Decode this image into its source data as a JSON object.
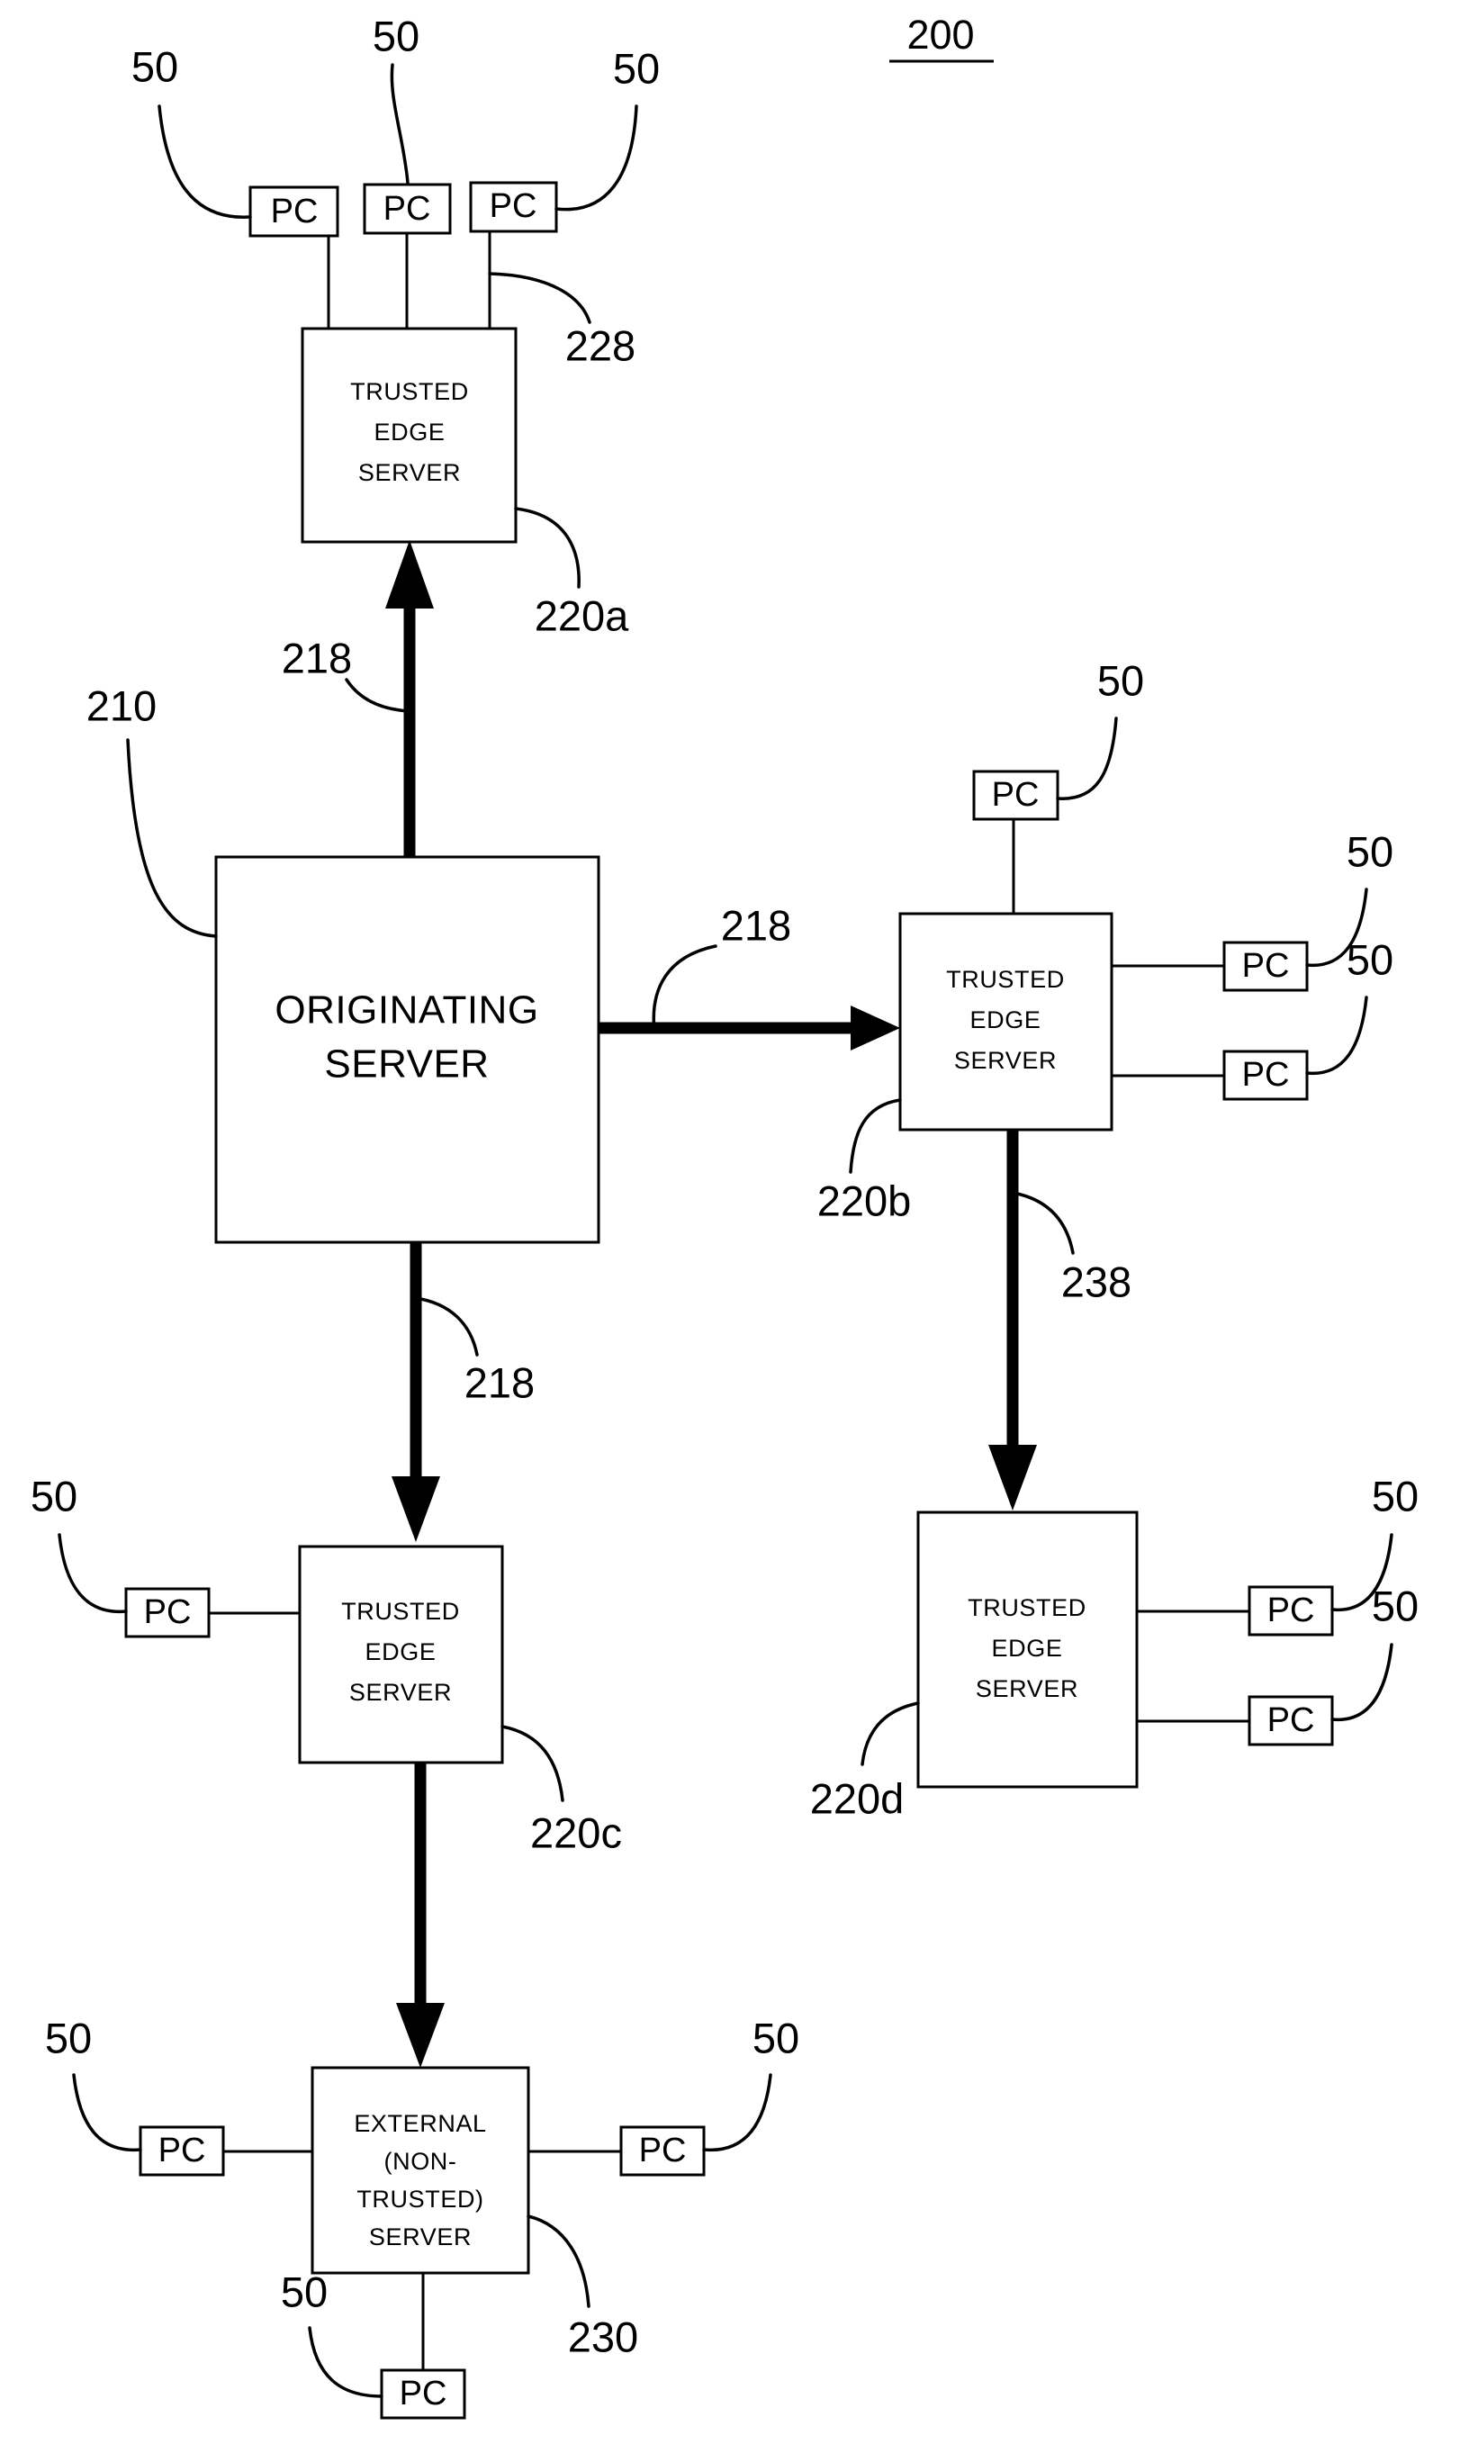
{
  "figure": {
    "number": "200",
    "underlined": true,
    "background_color": "#ffffff",
    "ink_color": "#000000"
  },
  "nodes": {
    "originating_server": {
      "label_line1": "ORIGINATING",
      "label_line2": "SERVER",
      "ref": "210"
    },
    "trusted_edge_server_a": {
      "label_line1": "TRUSTED",
      "label_line2": "EDGE",
      "label_line3": "SERVER",
      "ref": "220a"
    },
    "trusted_edge_server_b": {
      "label_line1": "TRUSTED",
      "label_line2": "EDGE",
      "label_line3": "SERVER",
      "ref": "220b"
    },
    "trusted_edge_server_c": {
      "label_line1": "TRUSTED",
      "label_line2": "EDGE",
      "label_line3": "SERVER",
      "ref": "220c"
    },
    "trusted_edge_server_d": {
      "label_line1": "TRUSTED",
      "label_line2": "EDGE",
      "label_line3": "SERVER",
      "ref": "220d"
    },
    "external_server": {
      "label_line1": "EXTERNAL",
      "label_line2": "(NON-",
      "label_line3": "TRUSTED)",
      "label_line4": "SERVER",
      "ref": "230"
    }
  },
  "pc_label": "PC",
  "pc_ref": "50",
  "pcs": [
    {
      "id": "pc-a1",
      "label": "PC",
      "ref": "50",
      "attached_to": "trusted_edge_server_a"
    },
    {
      "id": "pc-a2",
      "label": "PC",
      "ref": "50",
      "attached_to": "trusted_edge_server_a"
    },
    {
      "id": "pc-a3",
      "label": "PC",
      "ref": "50",
      "attached_to": "trusted_edge_server_a"
    },
    {
      "id": "pc-b1",
      "label": "PC",
      "ref": "50",
      "attached_to": "trusted_edge_server_b"
    },
    {
      "id": "pc-b2",
      "label": "PC",
      "ref": "50",
      "attached_to": "trusted_edge_server_b"
    },
    {
      "id": "pc-b3",
      "label": "PC",
      "ref": "50",
      "attached_to": "trusted_edge_server_b"
    },
    {
      "id": "pc-c1",
      "label": "PC",
      "ref": "50",
      "attached_to": "trusted_edge_server_c"
    },
    {
      "id": "pc-d1",
      "label": "PC",
      "ref": "50",
      "attached_to": "trusted_edge_server_d"
    },
    {
      "id": "pc-d2",
      "label": "PC",
      "ref": "50",
      "attached_to": "trusted_edge_server_d"
    },
    {
      "id": "pc-e1",
      "label": "PC",
      "ref": "50",
      "attached_to": "external_server"
    },
    {
      "id": "pc-e2",
      "label": "PC",
      "ref": "50",
      "attached_to": "external_server"
    },
    {
      "id": "pc-e3",
      "label": "PC",
      "ref": "50",
      "attached_to": "external_server"
    }
  ],
  "connections": {
    "origin_to_a": {
      "ref": "218",
      "direction": "up"
    },
    "origin_to_b": {
      "ref": "218",
      "direction": "right"
    },
    "origin_to_c": {
      "ref": "218",
      "direction": "down"
    },
    "b_to_d": {
      "ref": "238",
      "direction": "down"
    },
    "c_to_external": {
      "ref": "",
      "direction": "down"
    },
    "lan_a": {
      "ref": "228"
    }
  },
  "ref_numbers": {
    "fig": "200",
    "pc": "50",
    "originating_server": "210",
    "link_218": "218",
    "lan_228": "228",
    "link_238": "238",
    "edge_a": "220a",
    "edge_b": "220b",
    "edge_c": "220c",
    "edge_d": "220d",
    "external": "230"
  }
}
